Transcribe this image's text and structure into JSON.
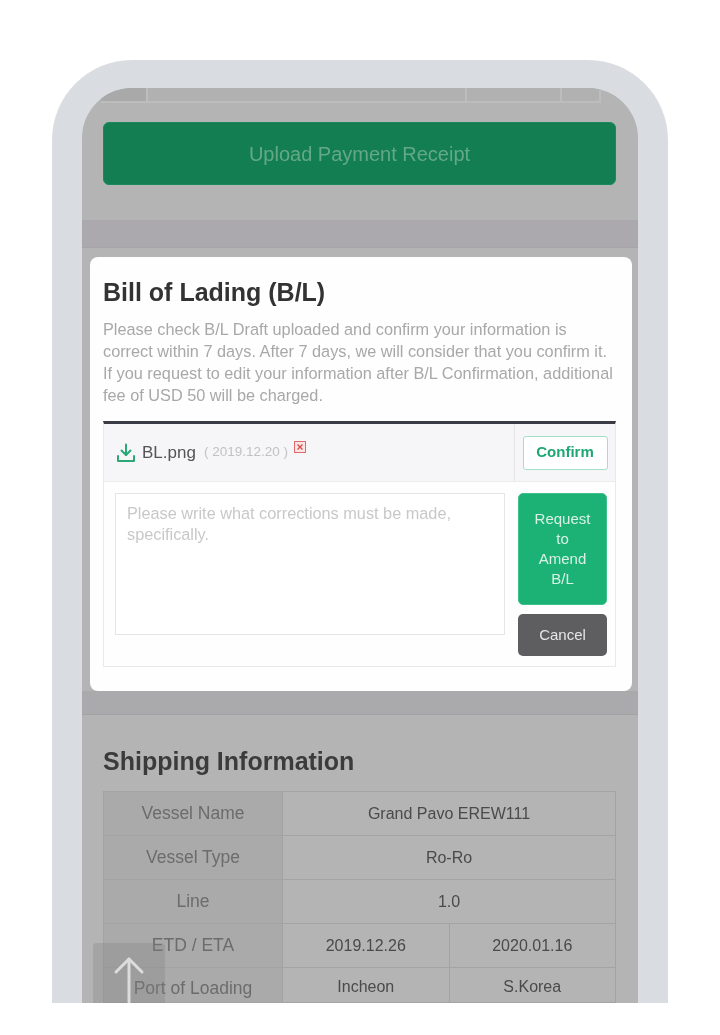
{
  "page": {
    "upload_button": "Upload Payment Receipt"
  },
  "modal": {
    "title": "Bill of Lading (B/L)",
    "description": "Please check B/L Draft uploaded and confirm your information is correct within 7 days. After 7 days, we will consider that you confirm it. If you request to edit your information after B/L Confirmation, additional fee of USD 50 will be charged.",
    "file": {
      "name": "BL.png",
      "date": "( 2019.12.20 )"
    },
    "confirm_button": "Confirm",
    "corrections": {
      "placeholder": "Please write what corrections must be made, specifically."
    },
    "amend_button": "Request to Amend B/L",
    "cancel_button": "Cancel"
  },
  "shipping_information": {
    "title": "Shipping Information",
    "rows": [
      {
        "label": "Vessel Name",
        "values": [
          "Grand Pavo EREW111"
        ]
      },
      {
        "label": "Vessel Type",
        "values": [
          "Ro-Ro"
        ]
      },
      {
        "label": "Line",
        "values": [
          "1.0"
        ]
      },
      {
        "label": "ETD / ETA",
        "values": [
          "2019.12.26",
          "2020.01.16"
        ]
      },
      {
        "label": "Port of Loading",
        "values": [
          "Incheon",
          "S.Korea"
        ]
      }
    ]
  }
}
